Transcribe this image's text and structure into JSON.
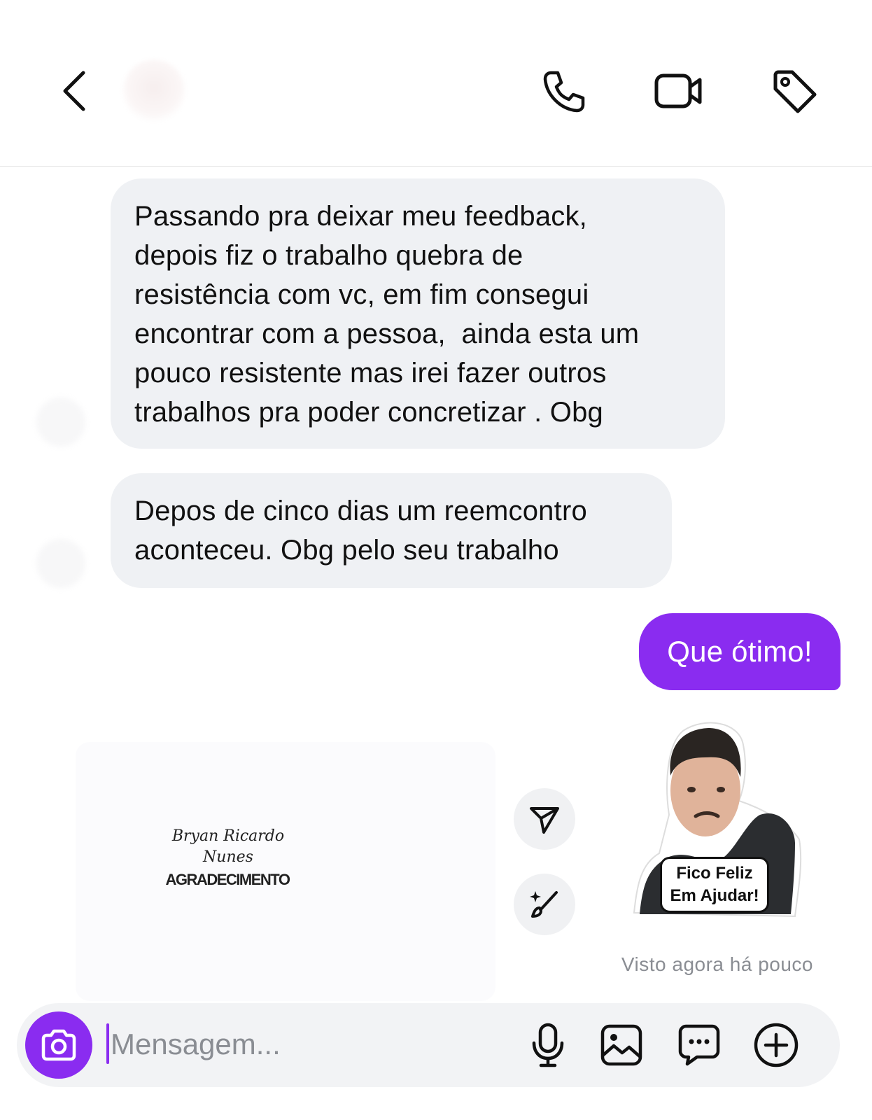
{
  "header": {
    "back_icon": "chevron-left-icon",
    "contact_name": "",
    "actions": [
      "phone-icon",
      "video-camera-icon",
      "tag-icon"
    ]
  },
  "messages": [
    {
      "direction": "incoming",
      "lines": [
        "Passando pra deixar meu feedback,",
        "depois fiz o trabalho quebra de",
        "resistência com vc, em fim consegui",
        "encontrar com a pessoa,  ainda esta um",
        "pouco resistente mas irei fazer outros",
        "trabalhos pra poder concretizar . Obg"
      ]
    },
    {
      "direction": "incoming",
      "lines": [
        "Depos de cinco dias um reemcontro",
        "aconteceu. Obg pelo seu trabalho"
      ]
    },
    {
      "direction": "outgoing",
      "text": "Que ótimo!",
      "color": "#8a2cf0"
    }
  ],
  "shared_card": {
    "signature_lines": [
      "Bryan Ricardo",
      "Nunes"
    ],
    "title": "AGRADECIMENTO"
  },
  "sticker": {
    "lines": [
      "Fico Feliz",
      "Em Ajudar!"
    ]
  },
  "seen_status": "Visto agora há pouco",
  "composer": {
    "placeholder": "Mensagem...",
    "value": "",
    "left_icon": "camera-icon",
    "right_icons": [
      "microphone-icon",
      "gallery-icon",
      "sticker-icon",
      "plus-circle-icon"
    ]
  },
  "colors": {
    "accent": "#8a2cf0",
    "incoming_bubble": "#eff1f4",
    "muted_text": "#8a8d93"
  }
}
